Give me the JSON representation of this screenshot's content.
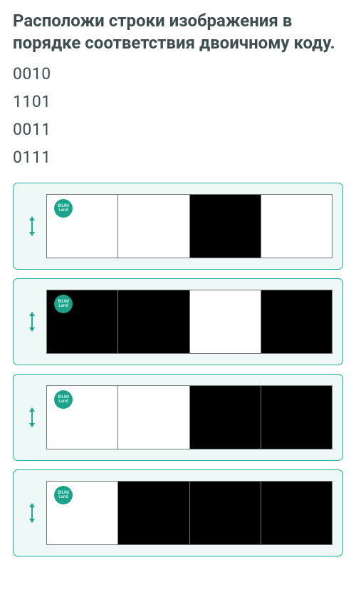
{
  "title": "Расположи строки изображения в порядке соответствия двоичному коду.",
  "codes": [
    "0010",
    "1101",
    "0011",
    "0111"
  ],
  "badge_text": "BILIM\nLand",
  "cards": [
    {
      "pattern": [
        0,
        0,
        1,
        0
      ]
    },
    {
      "pattern": [
        1,
        1,
        0,
        1
      ]
    },
    {
      "pattern": [
        0,
        0,
        1,
        1
      ]
    },
    {
      "pattern": [
        0,
        1,
        1,
        1
      ]
    }
  ],
  "colors": {
    "accent": "#1fb0a0",
    "card_bg": "#eef8f6",
    "black": "#000000",
    "white": "#ffffff"
  }
}
